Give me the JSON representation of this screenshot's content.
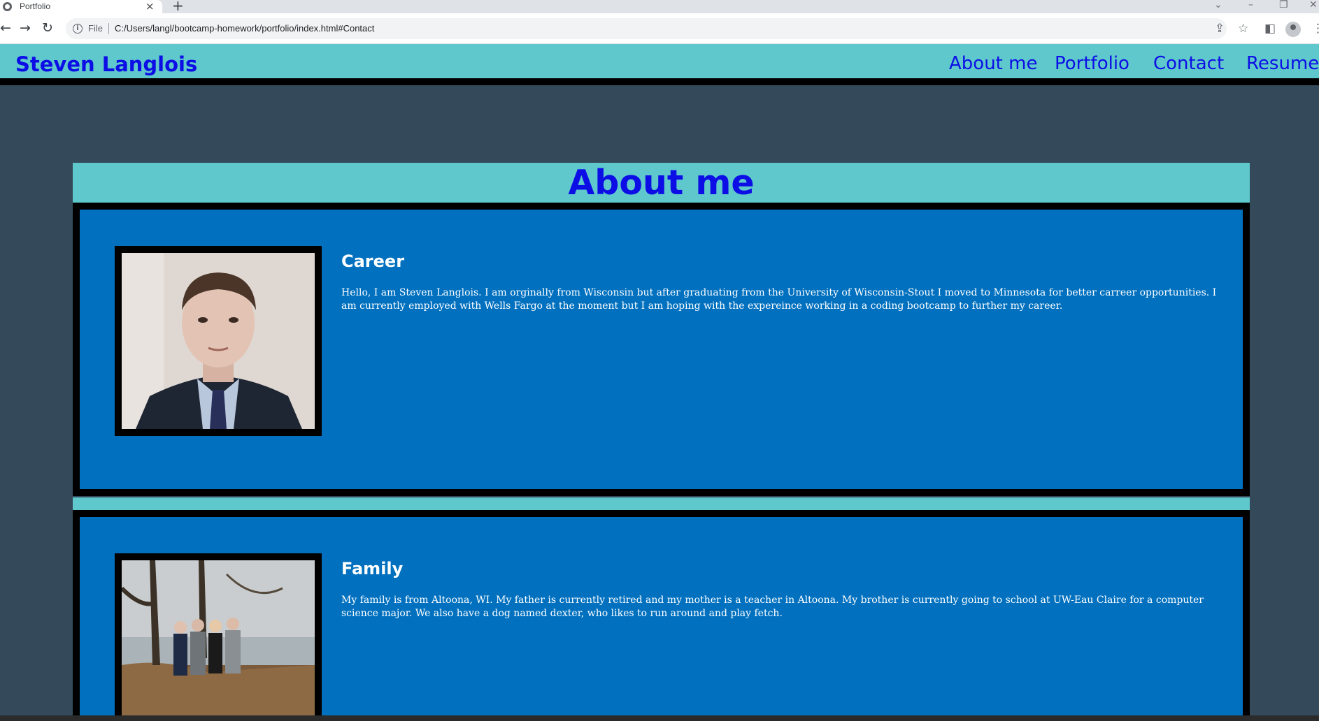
{
  "browser": {
    "tab_title": "Portfolio",
    "tab_close": "×",
    "new_tab": "+",
    "file_label": "File",
    "url": "C:/Users/langl/bootcamp-homework/portfolio/index.html#Contact",
    "icons": [
      "back-icon",
      "forward-icon",
      "reload-icon",
      "info-icon",
      "share-icon",
      "star-icon",
      "side-panel-icon",
      "profile-icon",
      "menu-icon"
    ]
  },
  "header": {
    "site_name": "Steven Langlois",
    "nav": [
      "About me",
      "Portfolio",
      "Contact",
      "Resume"
    ]
  },
  "main": {
    "section_title": "About me",
    "cards": [
      {
        "title": "Career",
        "text": "Hello, I am Steven Langlois. I am orginally from Wisconsin but after graduating from the University of Wisconsin-Stout I moved to Minnesota for better carreer opportunities. I am currently employed with Wells Fargo at the moment but I am hoping with the expereince working in a coding bootcamp to further my career."
      },
      {
        "title": "Family",
        "text": "My family is from Altoona, WI. My father is currently retired and my mother is a teacher in Altoona. My brother is currently going to school at UW-Eau Claire for a computer science major. We also have a dog named dexter, who likes to run around and play fetch."
      }
    ]
  },
  "colors": {
    "header_bg": "#5ec8cc",
    "link": "#0d0ee6",
    "page_bg": "#344a5a",
    "card_bg": "#0070bf"
  }
}
